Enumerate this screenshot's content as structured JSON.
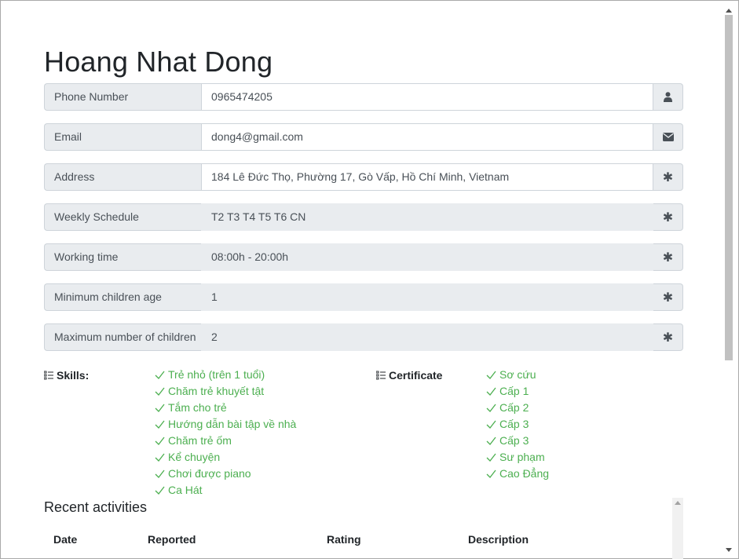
{
  "profile": {
    "name": "Hoang Nhat Dong"
  },
  "fields": [
    {
      "label": "Phone Number",
      "value": "0965474205",
      "icon": "user-icon"
    },
    {
      "label": "Email",
      "value": "dong4@gmail.com",
      "icon": "envelope-icon"
    },
    {
      "label": "Address",
      "value": "184 Lê Đức Thọ, Phường 17, Gò Vấp, Hồ Chí Minh, Vietnam",
      "icon": "asterisk-icon"
    },
    {
      "label": "Weekly Schedule",
      "value": "T2 T3 T4 T5 T6 CN",
      "icon": "asterisk-icon"
    },
    {
      "label": "Working time",
      "value": "08:00h - 20:00h",
      "icon": "asterisk-icon"
    },
    {
      "label": "Minimum children age",
      "value": "1",
      "icon": "asterisk-icon"
    },
    {
      "label": "Maximum number of children",
      "value": "2",
      "icon": "asterisk-icon"
    }
  ],
  "skills": {
    "heading": "Skills:",
    "items": [
      "Trẻ nhỏ (trên 1 tuổi)",
      "Chăm trẻ khuyết tật",
      "Tắm cho trẻ",
      "Hướng dẫn bài tập về nhà",
      "Chăm trẻ ốm",
      "Kể chuyện",
      "Chơi được piano",
      "Ca Hát"
    ]
  },
  "certificate": {
    "heading": "Certificate",
    "items": [
      "Sơ cứu",
      "Cấp 1",
      "Cấp 2",
      "Cấp 3",
      "Cấp 3",
      "Sư phạm",
      "Cao Đẳng"
    ]
  },
  "recent": {
    "title": "Recent activities",
    "columns": [
      "Date",
      "Reported",
      "Rating",
      "Description"
    ]
  },
  "colors": {
    "accent_green": "#4caf50",
    "addon_bg": "#e9ecef",
    "border": "#ced4da"
  }
}
